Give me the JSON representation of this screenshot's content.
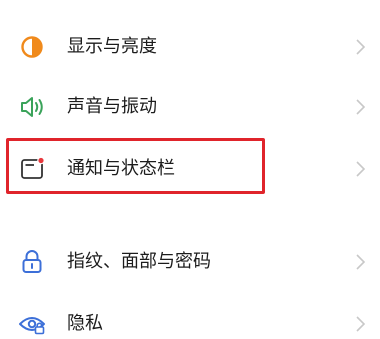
{
  "settings": {
    "items": [
      {
        "label": "显示与亮度",
        "icon": "display-brightness-icon",
        "color": "#f08a1c"
      },
      {
        "label": "声音与振动",
        "icon": "speaker-icon",
        "color": "#3aa35a"
      },
      {
        "label": "通知与状态栏",
        "icon": "notification-icon",
        "color": "#e8383d"
      },
      {
        "label": "指纹、面部与密码",
        "icon": "lock-icon",
        "color": "#3c6fd8"
      },
      {
        "label": "隐私",
        "icon": "privacy-eye-icon",
        "color": "#3c6fd8"
      }
    ],
    "highlight_color": "#e0242b",
    "chevron_icon": "chevron-right-icon"
  }
}
